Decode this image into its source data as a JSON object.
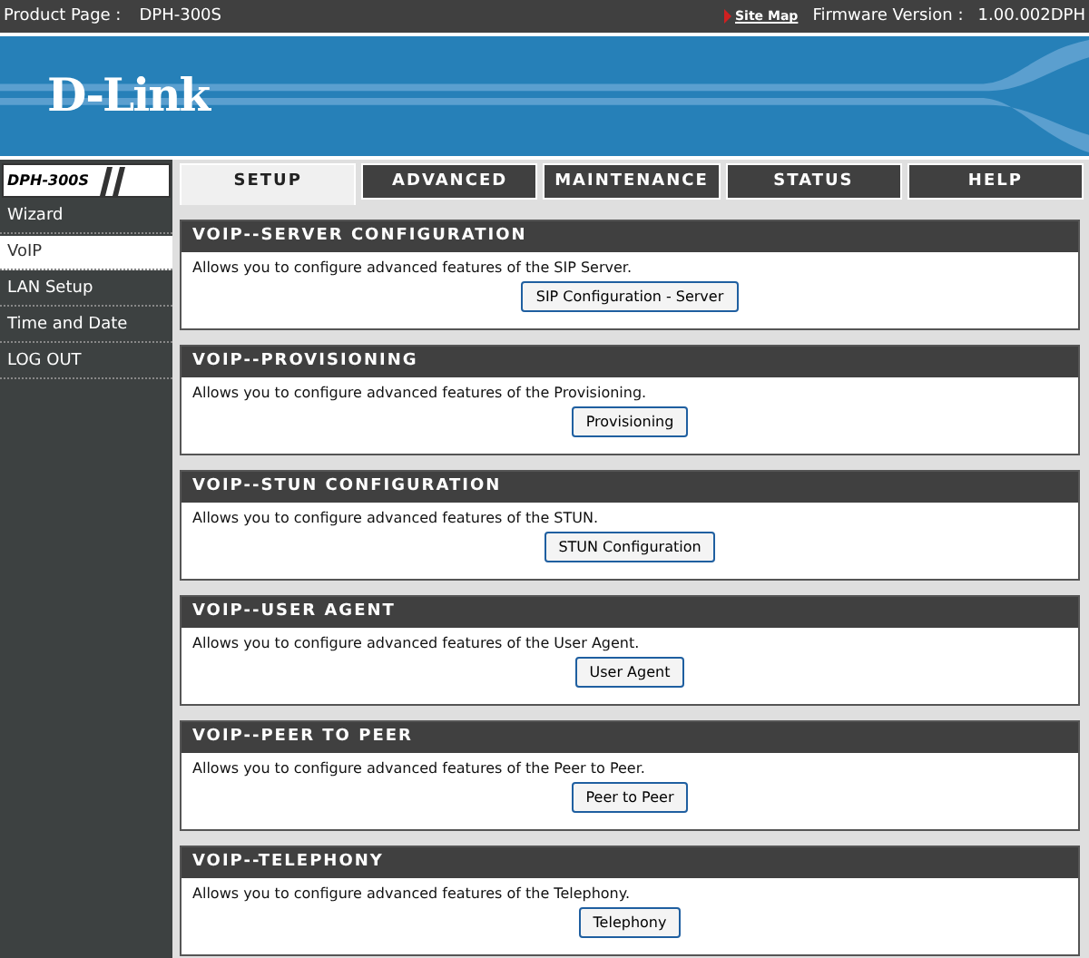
{
  "top_bar": {
    "product_label": "Product Page :",
    "product": "DPH-300S",
    "site_map": "Site Map",
    "firmware_label": "Firmware Version :",
    "firmware": "1.00.002DPH"
  },
  "banner": {
    "logo": "D-Link"
  },
  "sidebar": {
    "model": "DPH-300S",
    "items": [
      {
        "label": "Wizard",
        "selected": false
      },
      {
        "label": "VoIP",
        "selected": true
      },
      {
        "label": "LAN Setup",
        "selected": false
      },
      {
        "label": "Time and Date",
        "selected": false
      },
      {
        "label": "LOG OUT",
        "selected": false
      }
    ]
  },
  "tabs": [
    {
      "label": "SETUP",
      "selected": true
    },
    {
      "label": "ADVANCED",
      "selected": false
    },
    {
      "label": "MAINTENANCE",
      "selected": false
    },
    {
      "label": "STATUS",
      "selected": false
    },
    {
      "label": "HELP",
      "selected": false
    }
  ],
  "sections": [
    {
      "title": "VOIP--SERVER CONFIGURATION",
      "description": "Allows you to configure advanced features of the SIP Server.",
      "button": "SIP Configuration - Server"
    },
    {
      "title": "VOIP--PROVISIONING",
      "description": "Allows you to configure advanced features of the Provisioning.",
      "button": "Provisioning"
    },
    {
      "title": "VOIP--STUN CONFIGURATION",
      "description": "Allows you to configure advanced features of the STUN.",
      "button": "STUN Configuration"
    },
    {
      "title": "VOIP--USER AGENT",
      "description": "Allows you to configure advanced features of the User Agent.",
      "button": "User Agent"
    },
    {
      "title": "VOIP--PEER TO PEER",
      "description": "Allows you to configure advanced features of the Peer to Peer.",
      "button": "Peer to Peer"
    },
    {
      "title": "VOIP--TELEPHONY",
      "description": "Allows you to configure advanced features of the Telephony.",
      "button": "Telephony"
    }
  ]
}
